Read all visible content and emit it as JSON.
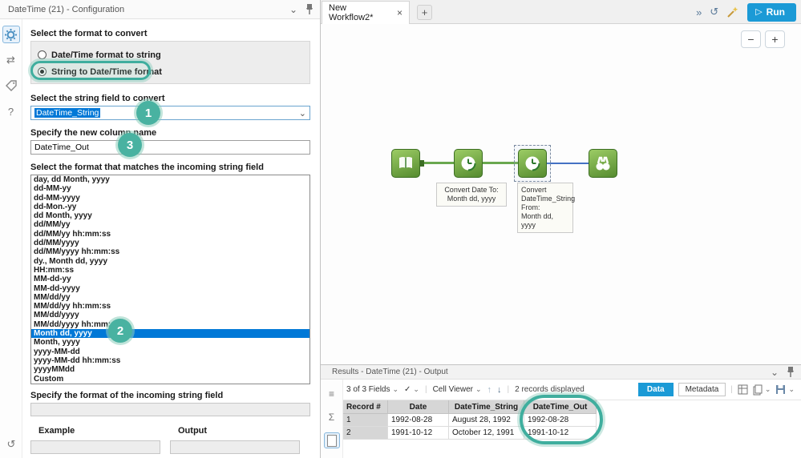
{
  "colors": {
    "accent_teal": "#3FAE9E",
    "selection_blue": "#0078D7",
    "run_blue": "#1B9AD6",
    "tool_green": "#558B2F",
    "connection_green": "#6AA84F",
    "connection_blue": "#4472C4"
  },
  "config": {
    "title": "DateTime (21) - Configuration",
    "format_choice": {
      "label": "Select the format to convert",
      "options": [
        "Date/Time format to string",
        "String to Date/Time format"
      ],
      "selected": "String to Date/Time format"
    },
    "string_field": {
      "label": "Select the string field to convert",
      "value": "DateTime_String"
    },
    "new_column": {
      "label": "Specify the new column name",
      "value": "DateTime_Out"
    },
    "format_list": {
      "label": "Select the format that matches the incoming string field",
      "selected": "Month dd, yyyy",
      "items": [
        "day, dd Month, yyyy",
        "dd-MM-yy",
        "dd-MM-yyyy",
        "dd-Mon.-yy",
        "dd Month, yyyy",
        "dd/MM/yy",
        "dd/MM/yy hh:mm:ss",
        "dd/MM/yyyy",
        "dd/MM/yyyy hh:mm:ss",
        "dy., Month dd, yyyy",
        "HH:mm:ss",
        "MM-dd-yy",
        "MM-dd-yyyy",
        "MM/dd/yy",
        "MM/dd/yy hh:mm:ss",
        "MM/dd/yyyy",
        "MM/dd/yyyy hh:mm:ss",
        "Month dd, yyyy",
        "Month, yyyy",
        "yyyy-MM-dd",
        "yyyy-MM-dd hh:mm:ss",
        "yyyyMMdd",
        "Custom"
      ]
    },
    "incoming_format": {
      "label": "Specify the format of the incoming string field",
      "value": ""
    },
    "example": {
      "label": "Example",
      "value": ""
    },
    "output": {
      "label": "Output",
      "value": ""
    },
    "badges": {
      "step1": "1",
      "step2": "2",
      "step3": "3"
    }
  },
  "canvas": {
    "tab_title": "New Workflow2*",
    "close": "×",
    "new_tab": "+",
    "run_label": "Run",
    "zoom_out": "−",
    "zoom_in": "+",
    "annotations": {
      "tool2": "Convert Date To:\nMonth dd, yyyy",
      "tool3": "Convert\nDateTime_String\nFrom:\nMonth dd, yyyy"
    }
  },
  "results": {
    "title": "Results - DateTime (21) - Output",
    "toolbar": {
      "fields": "3 of 3 Fields",
      "cell_viewer": "Cell Viewer",
      "records": "2 records displayed",
      "data_label": "Data",
      "metadata_label": "Metadata"
    },
    "table": {
      "headers": [
        "Record #",
        "Date",
        "DateTime_String",
        "DateTime_Out"
      ],
      "rows": [
        [
          "1",
          "1992-08-28",
          "August 28, 1992",
          "1992-08-28"
        ],
        [
          "2",
          "1991-10-12",
          "October 12, 1991",
          "1991-10-12"
        ]
      ]
    }
  }
}
